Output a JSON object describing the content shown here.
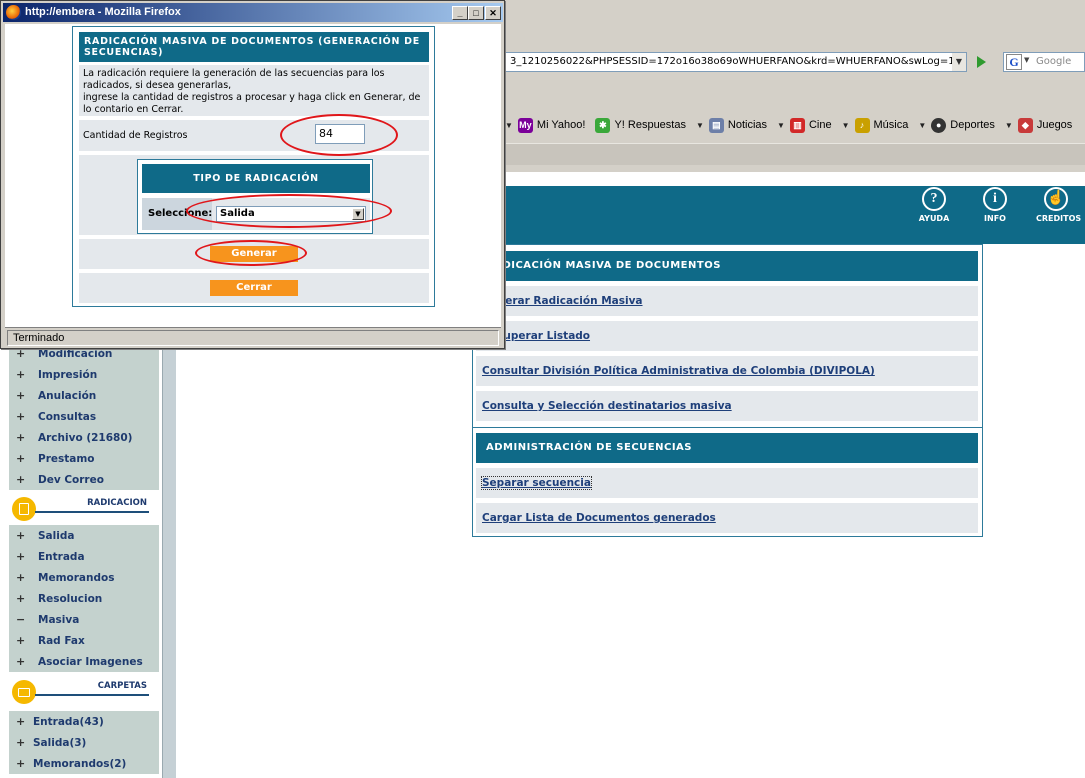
{
  "browser": {
    "url_text": "3_1210256022&PHPSESSID=172o16o38o69oWHUERFANO&krd=WHUERFANO&swLog=1",
    "search_placeholder": "Google",
    "bookmarks": [
      {
        "label": "Mi Yahoo!",
        "icon": "my-yahoo-icon",
        "color": "#7b0099"
      },
      {
        "label": "Y! Respuestas",
        "icon": "answers-icon",
        "color": "#3aa83a"
      },
      {
        "label": "Noticias",
        "icon": "news-icon",
        "color": "#6d7fa8"
      },
      {
        "label": "Cine",
        "icon": "popcorn-icon",
        "color": "#d22828"
      },
      {
        "label": "Música",
        "icon": "music-icon",
        "color": "#c9a000"
      },
      {
        "label": "Deportes",
        "icon": "soccer-ball-icon",
        "color": "#333333"
      },
      {
        "label": "Juegos",
        "icon": "game-cube-icon",
        "color": "#c83a3a"
      }
    ]
  },
  "header": {
    "icons": [
      {
        "label": "AYUDA",
        "glyph": "?"
      },
      {
        "label": "INFO",
        "glyph": "i"
      },
      {
        "label": "CREDITOS",
        "glyph": "☝"
      }
    ]
  },
  "main": {
    "section1_title": "RADICACIÓN MASIVA DE DOCUMENTOS",
    "section1_links": [
      "Generar Radicación Masiva",
      "Recuperar Listado",
      "Consultar División Política Administrativa de Colombia (DIVIPOLA)",
      "Consulta y Selección destinatarios masiva"
    ],
    "section2_title": "ADMINISTRACIÓN DE SECUENCIAS",
    "section2_links": [
      "Separar secuencia",
      "Cargar Lista de Documentos generados"
    ]
  },
  "sidebar": {
    "top_items": [
      {
        "label": "Modificación",
        "sign": "+"
      },
      {
        "label": "Impresión",
        "sign": "+"
      },
      {
        "label": "Anulación",
        "sign": "+"
      },
      {
        "label": "Consultas",
        "sign": "+"
      },
      {
        "label": "Archivo (21680)",
        "sign": "+"
      },
      {
        "label": "Prestamo",
        "sign": "+"
      },
      {
        "label": "Dev Correo",
        "sign": "+"
      }
    ],
    "radicacion_title": "RADICACION",
    "radicacion_items": [
      {
        "label": "Salida",
        "sign": "+"
      },
      {
        "label": "Entrada",
        "sign": "+"
      },
      {
        "label": "Memorandos",
        "sign": "+"
      },
      {
        "label": "Resolucion",
        "sign": "+"
      },
      {
        "label": "Masiva",
        "sign": "−"
      },
      {
        "label": "Rad Fax",
        "sign": "+"
      },
      {
        "label": "Asociar Imagenes",
        "sign": "+"
      }
    ],
    "carpetas_title": "CARPETAS",
    "carpetas_items": [
      {
        "label": "Entrada(43)",
        "sign": "+"
      },
      {
        "label": "Salida(3)",
        "sign": "+"
      },
      {
        "label": "Memorandos(2)",
        "sign": "+"
      }
    ]
  },
  "popup": {
    "title": "http://embera - Mozilla Firefox",
    "status": "Terminado",
    "form_title": "RADICACIÓN MASIVA DE DOCUMENTOS (GENERACIÓN DE SECUENCIAS)",
    "description_line1": "La radicación requiere la generación de las secuencias para los",
    "description_line2": "radicados, si desea generarlas,",
    "description_line3": "ingrese la cantidad de registros a procesar y haga click en Generar, de",
    "description_line4": "lo contario en Cerrar.",
    "qty_label": "Cantidad de Registros",
    "qty_value": "84",
    "tipo_title": "TIPO DE RADICACIÓN",
    "select_label": "Seleccione:",
    "select_value": "Salida",
    "generate_label": "Generar",
    "close_label": "Cerrar",
    "accent_orange": "#f7941d",
    "header_blue": "#0f6a88",
    "highlight_red": "#e0161a"
  }
}
